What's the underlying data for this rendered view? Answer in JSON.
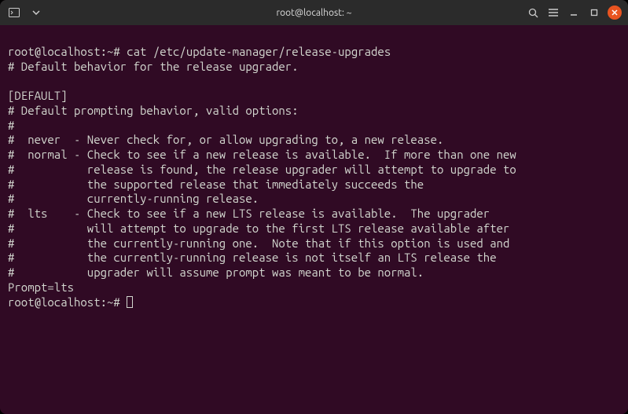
{
  "titlebar": {
    "title": "root@localhost: ~"
  },
  "terminal": {
    "prompt": "root@localhost:~#",
    "command1": "cat /etc/update-manager/release-upgrades",
    "output_lines": [
      "# Default behavior for the release upgrader.",
      "",
      "[DEFAULT]",
      "# Default prompting behavior, valid options:",
      "#",
      "#  never  - Never check for, or allow upgrading to, a new release.",
      "#  normal - Check to see if a new release is available.  If more than one new",
      "#           release is found, the release upgrader will attempt to upgrade to",
      "#           the supported release that immediately succeeds the",
      "#           currently-running release.",
      "#  lts    - Check to see if a new LTS release is available.  The upgrader",
      "#           will attempt to upgrade to the first LTS release available after",
      "#           the currently-running one.  Note that if this option is used and",
      "#           the currently-running release is not itself an LTS release the",
      "#           upgrader will assume prompt was meant to be normal.",
      "Prompt=lts"
    ]
  }
}
